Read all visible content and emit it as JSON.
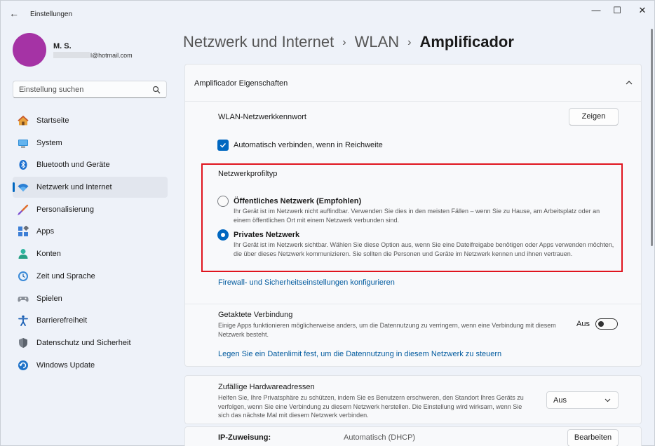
{
  "window": {
    "title": "Einstellungen",
    "back_glyph": "←",
    "controls": {
      "minimize": "—",
      "maximize": "☐",
      "close": "✕"
    }
  },
  "user": {
    "name": "M. S.",
    "email_suffix": "l@hotmail.com",
    "avatar_color": "#a533a5"
  },
  "search": {
    "placeholder": "Einstellung suchen",
    "icon": "search-icon"
  },
  "nav": [
    {
      "label": "Startseite",
      "icon": "home-icon",
      "selected": false
    },
    {
      "label": "System",
      "icon": "monitor-icon",
      "selected": false
    },
    {
      "label": "Bluetooth und Geräte",
      "icon": "bluetooth-icon",
      "selected": false
    },
    {
      "label": "Netzwerk und Internet",
      "icon": "wifi-icon",
      "selected": true
    },
    {
      "label": "Personalisierung",
      "icon": "brush-icon",
      "selected": false
    },
    {
      "label": "Apps",
      "icon": "apps-icon",
      "selected": false
    },
    {
      "label": "Konten",
      "icon": "person-icon",
      "selected": false
    },
    {
      "label": "Zeit und Sprache",
      "icon": "clock-globe-icon",
      "selected": false
    },
    {
      "label": "Spielen",
      "icon": "gamepad-icon",
      "selected": false
    },
    {
      "label": "Barrierefreiheit",
      "icon": "accessibility-icon",
      "selected": false
    },
    {
      "label": "Datenschutz und Sicherheit",
      "icon": "shield-icon",
      "selected": false
    },
    {
      "label": "Windows Update",
      "icon": "update-icon",
      "selected": false
    }
  ],
  "breadcrumb": {
    "part1": "Netzwerk und Internet",
    "part2": "WLAN",
    "current": "Amplificador",
    "separator": "›"
  },
  "properties": {
    "header": "Amplificador Eigenschaften",
    "password_label": "WLAN-Netzwerkkennwort",
    "show_button": "Zeigen",
    "auto_connect_label": "Automatisch verbinden, wenn in Reichweite",
    "auto_connect_checked": true,
    "profile_type_label": "Netzwerkprofiltyp",
    "public_title": "Öffentliches Netzwerk (Empfohlen)",
    "public_desc": "Ihr Gerät ist im Netzwerk nicht auffindbar. Verwenden Sie dies in den meisten Fällen – wenn Sie zu Hause, am Arbeitsplatz oder an einem öffentlichen Ort mit einem Netzwerk verbunden sind.",
    "private_title": "Privates Netzwerk",
    "private_desc": "Ihr Gerät ist im Netzwerk sichtbar. Wählen Sie diese Option aus, wenn Sie eine Dateifreigabe benötigen oder Apps verwenden möchten, die über dieses Netzwerk kommunizieren. Sie sollten die Personen und Geräte im Netzwerk kennen und ihnen vertrauen.",
    "selected_profile": "private",
    "firewall_link": "Firewall- und Sicherheitseinstellungen konfigurieren"
  },
  "metered": {
    "title": "Getaktete Verbindung",
    "desc": "Einige Apps funktionieren möglicherweise anders, um die Datennutzung zu verringern, wenn eine Verbindung mit diesem Netzwerk besteht.",
    "state_label": "Aus",
    "datalimit_link": "Legen Sie ein Datenlimit fest, um die Datennutzung in diesem Netzwerk zu steuern"
  },
  "random_hw": {
    "title": "Zufällige Hardwareadressen",
    "desc": "Helfen Sie, Ihre Privatsphäre zu schützen, indem Sie es Benutzern erschweren, den Standort Ihres Geräts zu verfolgen, wenn Sie eine Verbindung zu diesem Netzwerk herstellen. Die Einstellung wird wirksam, wenn Sie sich das nächste Mal mit diesem Netzwerk verbinden.",
    "select_value": "Aus"
  },
  "ip": {
    "label": "IP-Zuweisung:",
    "value": "Automatisch (DHCP)",
    "edit_button": "Bearbeiten"
  },
  "colors": {
    "accent": "#0067c0",
    "highlight_box": "#e0141e",
    "link": "#005a9e"
  }
}
